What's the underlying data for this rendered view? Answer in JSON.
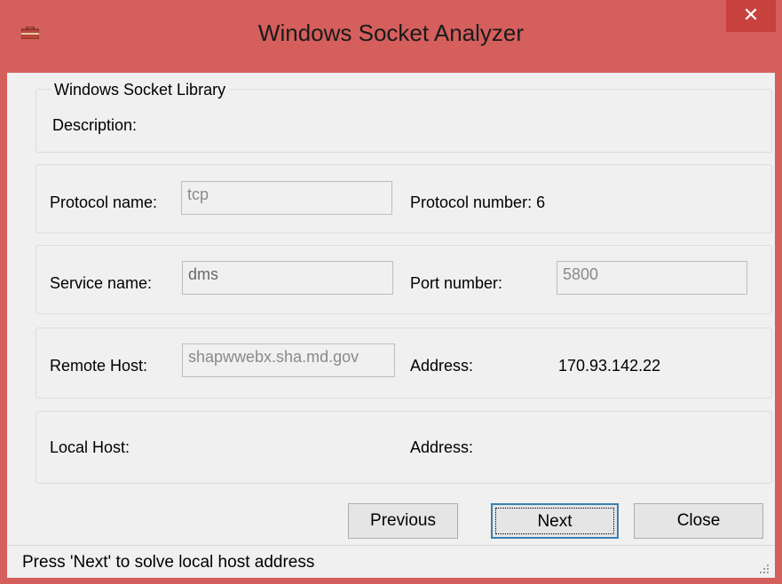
{
  "window": {
    "title": "Windows Socket Analyzer",
    "close_glyph": "✕",
    "app_icon": "toolbox-icon",
    "title_bar_color": "#d45f5c"
  },
  "library_group": {
    "legend": "Windows Socket Library",
    "description_label": "Description:"
  },
  "protocol": {
    "name_label": "Protocol name:",
    "name_value": "tcp",
    "number_label": "Protocol number: 6"
  },
  "service": {
    "name_label": "Service name:",
    "name_value": "dms",
    "port_label": "Port number:",
    "port_value": "5800"
  },
  "remote": {
    "host_label": "Remote Host:",
    "host_value": "shapwwebx.sha.md.gov",
    "address_label": "Address:",
    "address_value": "170.93.142.22"
  },
  "local": {
    "host_label": "Local Host:",
    "address_label": "Address:"
  },
  "buttons": {
    "previous": "Previous",
    "next": "Next",
    "close": "Close"
  },
  "status": {
    "text": "Press 'Next' to solve local host address"
  }
}
